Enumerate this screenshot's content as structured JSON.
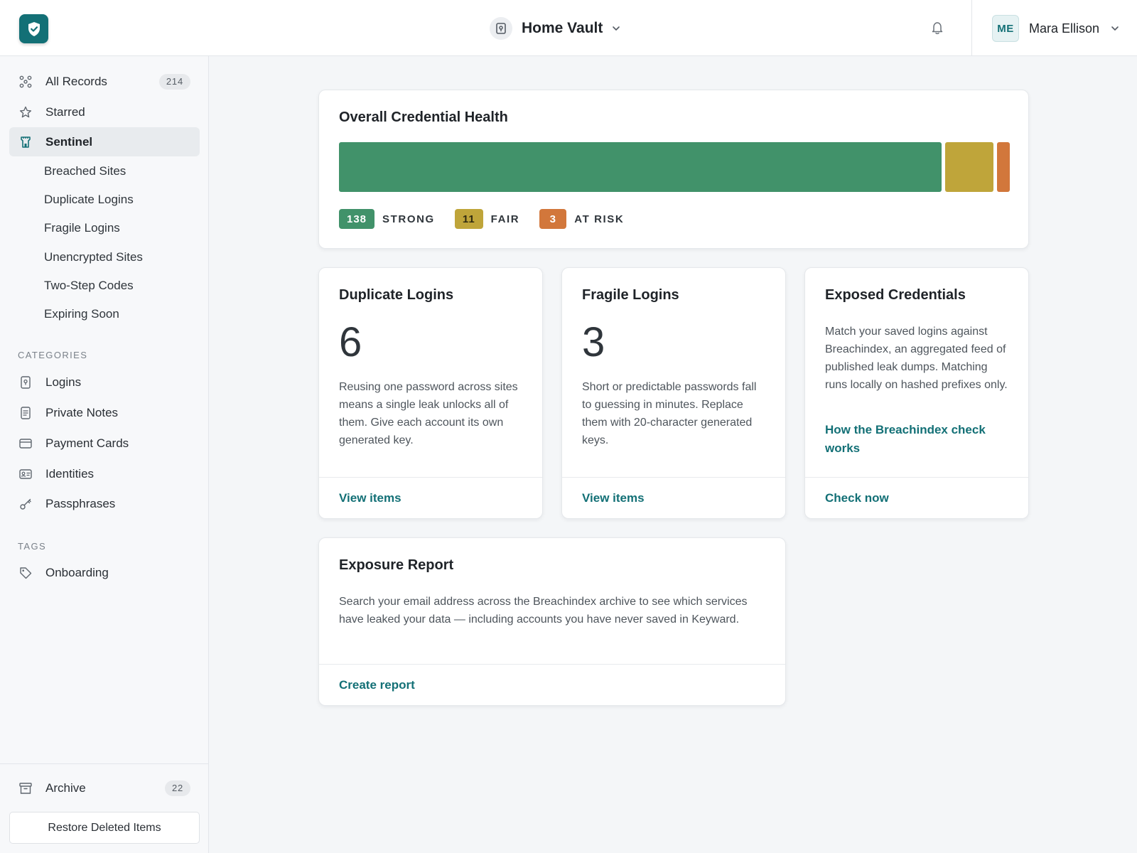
{
  "header": {
    "vault_name": "Home Vault",
    "user_initials": "ME",
    "user_name": "Mara Ellison"
  },
  "colors": {
    "brand": "#137076",
    "strong": "#41926a",
    "fair": "#bfa53a",
    "at_risk": "#d2773b"
  },
  "sidebar": {
    "main_items": [
      {
        "label": "All Records",
        "icon": "grid-nodes-icon",
        "count": "214"
      },
      {
        "label": "Starred",
        "icon": "star-icon"
      },
      {
        "label": "Sentinel",
        "icon": "watchtower-icon",
        "active": true
      }
    ],
    "sentinel_items": [
      {
        "label": "Breached Sites"
      },
      {
        "label": "Duplicate Logins"
      },
      {
        "label": "Fragile Logins"
      },
      {
        "label": "Unencrypted Sites"
      },
      {
        "label": "Two-Step Codes"
      },
      {
        "label": "Expiring Soon"
      }
    ],
    "categories_label": "CATEGORIES",
    "categories": [
      {
        "label": "Logins",
        "icon": "login-icon"
      },
      {
        "label": "Private Notes",
        "icon": "note-icon"
      },
      {
        "label": "Payment Cards",
        "icon": "card-icon"
      },
      {
        "label": "Identities",
        "icon": "id-card-icon"
      },
      {
        "label": "Passphrases",
        "icon": "key-icon"
      }
    ],
    "tags_label": "TAGS",
    "tags": [
      {
        "label": "Onboarding",
        "icon": "tag-icon"
      }
    ],
    "archive": {
      "label": "Archive",
      "count": "22"
    },
    "restore_label": "Restore Deleted Items"
  },
  "health": {
    "title": "Overall Credential Health",
    "segments": [
      {
        "count": "138",
        "value": 138,
        "label": "STRONG"
      },
      {
        "count": "11",
        "value": 11,
        "label": "FAIR"
      },
      {
        "count": "3",
        "value": 3,
        "label": "AT RISK"
      }
    ]
  },
  "cards": {
    "duplicate": {
      "title": "Duplicate Logins",
      "number": "6",
      "description": "Reusing one password across sites means a single leak unlocks all of them. Give each account its own generated key.",
      "action": "View items"
    },
    "fragile": {
      "title": "Fragile Logins",
      "number": "3",
      "description": "Short or predictable passwords fall to guessing in minutes. Replace them with 20-character generated keys.",
      "action": "View items"
    },
    "exposed": {
      "title": "Exposed Credentials",
      "description": "Match your saved logins against Breachindex, an aggregated feed of published leak dumps. Matching runs locally on hashed prefixes only.",
      "link": "How the Breachindex check works",
      "action": "Check now"
    },
    "report": {
      "title": "Exposure Report",
      "description": "Search your email address across the Breachindex archive to see which services have leaked your data — including accounts you have never saved in Keyward.",
      "action": "Create report"
    }
  }
}
